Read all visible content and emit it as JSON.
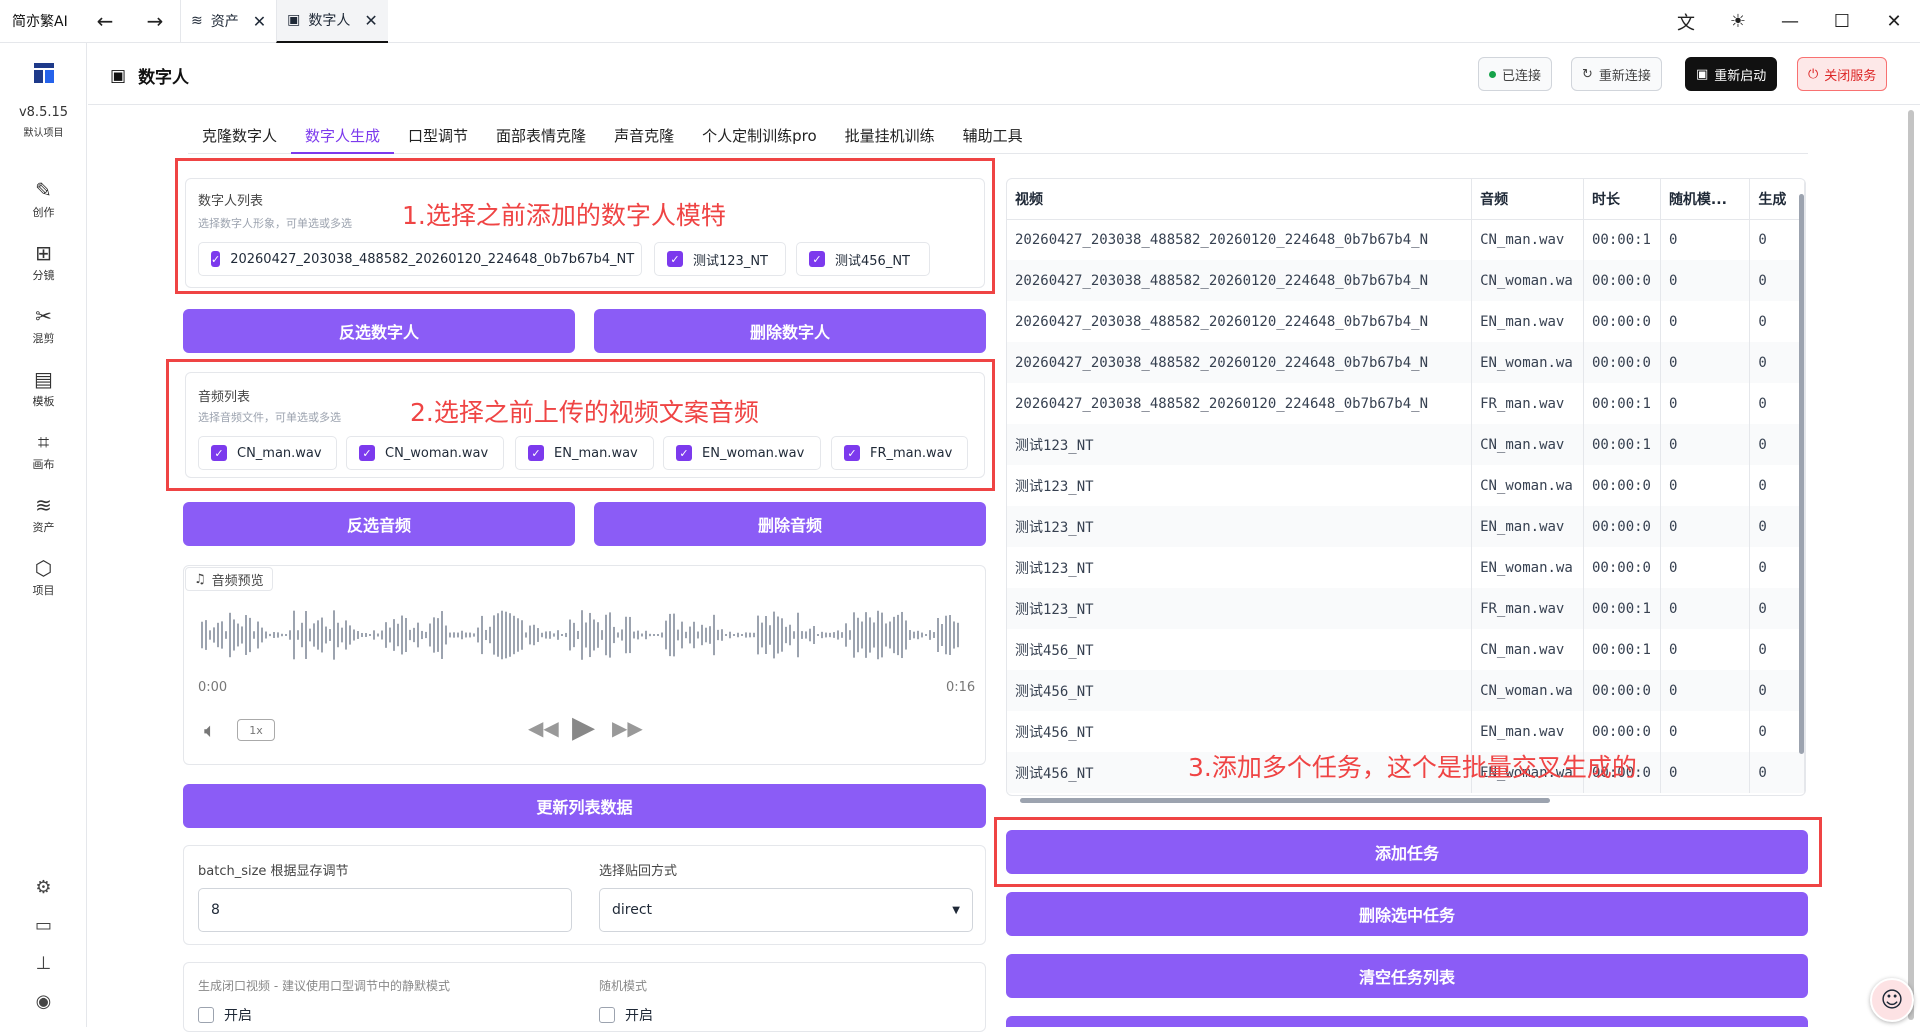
{
  "titlebar": {
    "app_name": "简亦繁AI",
    "tabs": [
      {
        "label": "资产",
        "icon": "layers-icon"
      },
      {
        "label": "数字人",
        "icon": "portrait-icon"
      }
    ]
  },
  "sidebar": {
    "version": "v8.5.15",
    "project": "默认项目",
    "items": [
      {
        "label": "创作",
        "icon": "pencil-icon"
      },
      {
        "label": "分镜",
        "icon": "storyboard-icon"
      },
      {
        "label": "混剪",
        "icon": "scissors-icon"
      },
      {
        "label": "模板",
        "icon": "clapper-icon"
      },
      {
        "label": "画布",
        "icon": "canvas-icon"
      },
      {
        "label": "资产",
        "icon": "layers-icon"
      },
      {
        "label": "项目",
        "icon": "box-icon"
      }
    ]
  },
  "header": {
    "title": "数字人",
    "status": "已连接",
    "reconnect": "重新连接",
    "restart": "重新启动",
    "shutdown": "关闭服务"
  },
  "subtabs": [
    "克隆数字人",
    "数字人生成",
    "口型调节",
    "面部表情克隆",
    "声音克隆",
    "个人定制训练pro",
    "批量挂机训练",
    "辅助工具"
  ],
  "digital_humans": {
    "label": "数字人列表",
    "hint": "选择数字人形象，可单选或多选",
    "items": [
      "20260427_203038_488582_20260120_224648_0b7b67b4_NT",
      "测试123_NT",
      "测试456_NT"
    ]
  },
  "annotations": {
    "step1": "1.选择之前添加的数字人模特",
    "step2": "2.选择之前上传的视频文案音频",
    "step3": "3.添加多个任务，这个是批量交叉生成的"
  },
  "buttons": {
    "invert_humans": "反选数字人",
    "delete_humans": "删除数字人",
    "invert_audio": "反选音频",
    "delete_audio": "删除音频",
    "refresh": "更新列表数据",
    "add_task": "添加任务",
    "delete_selected": "删除选中任务",
    "clear_tasks": "清空任务列表"
  },
  "audio": {
    "label": "音频列表",
    "hint": "选择音频文件，可单选或多选",
    "items": [
      "CN_man.wav",
      "CN_woman.wav",
      "EN_man.wav",
      "EN_woman.wav",
      "FR_man.wav"
    ]
  },
  "preview": {
    "label": "音频预览",
    "start": "0:00",
    "end": "0:16",
    "speed": "1x"
  },
  "batch": {
    "label": "batch_size 根据显存调节",
    "value": "8"
  },
  "paste_mode": {
    "label": "选择贴回方式",
    "value": "direct"
  },
  "closed_mouth": {
    "label": "生成闭口视频 - 建议使用口型调节中的静默模式",
    "option": "开启"
  },
  "random_mode": {
    "label": "随机模式",
    "option": "开启"
  },
  "tasks": {
    "columns": [
      "视频",
      "音频",
      "时长",
      "随机模...",
      "生成"
    ],
    "rows": [
      [
        "20260427_203038_488582_20260120_224648_0b7b67b4_N",
        "CN_man.wav",
        "00:00:1",
        "0",
        "0"
      ],
      [
        "20260427_203038_488582_20260120_224648_0b7b67b4_N",
        "CN_woman.wa",
        "00:00:0",
        "0",
        "0"
      ],
      [
        "20260427_203038_488582_20260120_224648_0b7b67b4_N",
        "EN_man.wav",
        "00:00:0",
        "0",
        "0"
      ],
      [
        "20260427_203038_488582_20260120_224648_0b7b67b4_N",
        "EN_woman.wa",
        "00:00:0",
        "0",
        "0"
      ],
      [
        "20260427_203038_488582_20260120_224648_0b7b67b4_N",
        "FR_man.wav",
        "00:00:1",
        "0",
        "0"
      ],
      [
        "测试123_NT",
        "CN_man.wav",
        "00:00:1",
        "0",
        "0"
      ],
      [
        "测试123_NT",
        "CN_woman.wa",
        "00:00:0",
        "0",
        "0"
      ],
      [
        "测试123_NT",
        "EN_man.wav",
        "00:00:0",
        "0",
        "0"
      ],
      [
        "测试123_NT",
        "EN_woman.wa",
        "00:00:0",
        "0",
        "0"
      ],
      [
        "测试123_NT",
        "FR_man.wav",
        "00:00:1",
        "0",
        "0"
      ],
      [
        "测试456_NT",
        "CN_man.wav",
        "00:00:1",
        "0",
        "0"
      ],
      [
        "测试456_NT",
        "CN_woman.wa",
        "00:00:0",
        "0",
        "0"
      ],
      [
        "测试456_NT",
        "EN_man.wav",
        "00:00:0",
        "0",
        "0"
      ],
      [
        "测试456_NT",
        "EN_woman.wa",
        "00:00:0",
        "0",
        "0"
      ]
    ]
  },
  "colors": {
    "accent": "#8b5cf6",
    "annotation": "#ef4444",
    "connected": "#16a34a"
  }
}
